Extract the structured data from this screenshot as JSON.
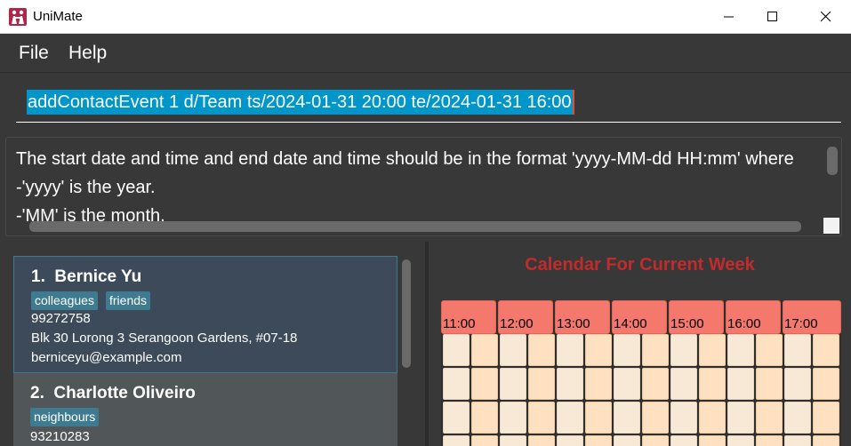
{
  "window": {
    "title": "UniMate"
  },
  "menu": {
    "items": [
      "File",
      "Help"
    ]
  },
  "command": {
    "value": "addContactEvent 1 d/Team ts/2024-01-31 20:00 te/2024-01-31 16:00"
  },
  "result": {
    "lines": [
      "The start date and time and end date and time should be in the format 'yyyy-MM-dd HH:mm' where",
      "   -'yyyy' is the year.",
      "   -'MM' is the month."
    ]
  },
  "persons": [
    {
      "index": "1.",
      "name": "Bernice Yu",
      "tags": [
        "colleagues",
        "friends"
      ],
      "phone": "99272758",
      "address": "Blk 30 Lorong 3 Serangoon Gardens, #07-18",
      "email": "berniceyu@example.com"
    },
    {
      "index": "2.",
      "name": "Charlotte Oliveiro",
      "tags": [
        "neighbours"
      ],
      "phone": "93210283"
    }
  ],
  "calendar": {
    "title": "Calendar For Current Week",
    "hours": [
      "11:00",
      "12:00",
      "13:00",
      "14:00",
      "15:00",
      "16:00",
      "17:00"
    ],
    "colors": {
      "header": "#f4786c",
      "title": "#c22b2b",
      "cell_light": "#f8e8d6",
      "cell_peach": "#fde1c0"
    }
  },
  "colors": {
    "selection": "#0096c9",
    "tag": "#3e7b91",
    "selected_card": "#3c4a5a"
  }
}
